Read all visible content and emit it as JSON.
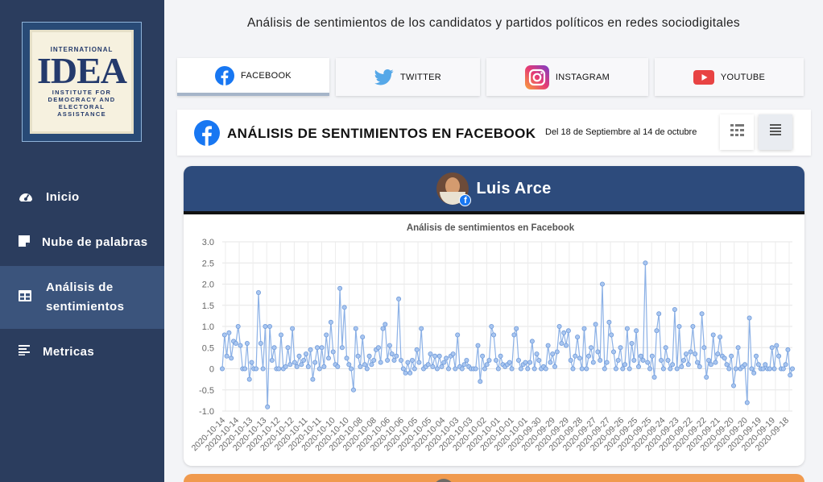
{
  "sidebar": {
    "logo": {
      "line1": "INTERNATIONAL",
      "line2": "IDEA",
      "line3": "INSTITUTE FOR",
      "line4": "DEMOCRACY AND",
      "line5": "ELECTORAL",
      "line6": "ASSISTANCE"
    },
    "items": [
      {
        "label": "Inicio",
        "icon": "speedometer-icon"
      },
      {
        "label": "Nube de palabras",
        "icon": "note-icon"
      },
      {
        "label_line1": "Análisis de",
        "label_line2": "sentimientos",
        "icon": "table-icon",
        "active": true
      },
      {
        "label": "Metricas",
        "icon": "text-lines-icon"
      }
    ]
  },
  "main": {
    "title": "Análisis de sentimientos de los candidatos y partidos políticos en redes sociodigitales",
    "tabs": [
      {
        "label": "FACEBOOK",
        "icon": "facebook-icon",
        "active": true
      },
      {
        "label": "TWITTER",
        "icon": "twitter-icon"
      },
      {
        "label": "INSTAGRAM",
        "icon": "instagram-icon"
      },
      {
        "label": "YOUTUBE",
        "icon": "youtube-icon"
      }
    ],
    "header": {
      "title": "ANÁLISIS DE SENTIMIENTOS EN FACEBOOK",
      "range": "Del 18 de Septiembre al 14 de octubre",
      "grid_icon": "grid-view-icon",
      "list_icon": "list-view-icon"
    },
    "panel": {
      "name": "Luis Arce",
      "header_color": "#2d4b7c",
      "next_panel_color": "#f09a4e"
    }
  },
  "colors": {
    "sidebar_bg": "#2b3d5e",
    "sidebar_active": "#3b547c",
    "line": "#8cb1e6",
    "marker": "#a9c6f0"
  },
  "chart_data": {
    "type": "line",
    "title": "Análisis de sentimientos en Facebook",
    "xlabel": "",
    "ylabel": "",
    "ylim": [
      -1.0,
      3.0
    ],
    "yticks": [
      3.0,
      2.5,
      2.0,
      1.5,
      1.0,
      0.5,
      0,
      -0.5,
      -1.0
    ],
    "ytick_labels": [
      "3.0",
      "2.5",
      "2.0",
      "1.5",
      "1.0",
      "0.5",
      "0",
      "-0.5",
      "-1.0"
    ],
    "grid": true,
    "x_tick_labels": [
      "2020-10-14",
      "2020-10-14",
      "2020-10-13",
      "2020-10-13",
      "2020-10-12",
      "2020-10-12",
      "2020-10-11",
      "2020-10-11",
      "2020-10-10",
      "2020-10-10",
      "2020-10-08",
      "2020-10-08",
      "2020-10-06",
      "2020-10-06",
      "2020-10-05",
      "2020-10-05",
      "2020-10-04",
      "2020-10-03",
      "2020-10-03",
      "2020-10-02",
      "2020-10-01",
      "2020-10-01",
      "2020-10-01",
      "2020-09-30",
      "2020-09-29",
      "2020-09-29",
      "2020-09-28",
      "2020-09-27",
      "2020-09-27",
      "2020-09-26",
      "2020-09-25",
      "2020-09-25",
      "2020-09-24",
      "2020-09-23",
      "2020-09-22",
      "2020-09-22",
      "2020-09-21",
      "2020-09-20",
      "2020-09-20",
      "2020-09-19",
      "2020-09-19",
      "2020-09-18"
    ],
    "series": [
      {
        "values": [
          0,
          0.8,
          0.3,
          0.85,
          0.25,
          0.65,
          0.6,
          1.0,
          0.55,
          0,
          0,
          0.6,
          -0.25,
          0.15,
          0,
          0,
          1.8,
          0.6,
          0,
          1.0,
          -0.9,
          1.0,
          0.2,
          0.5,
          0,
          0,
          0.8,
          0,
          0.05,
          0.5,
          0.1,
          0.95,
          0.15,
          0.05,
          0.3,
          0.1,
          0.2,
          0.35,
          0.05,
          0.45,
          -0.25,
          0.15,
          0.5,
          0,
          0.5,
          0.05,
          0.8,
          0.25,
          1.1,
          0.4,
          0.1,
          0.05,
          1.9,
          0.5,
          1.45,
          0.25,
          0.1,
          0,
          -0.5,
          0.95,
          0.3,
          0.05,
          0.75,
          0.1,
          0,
          0.3,
          0.1,
          0.2,
          0.45,
          0.5,
          0.15,
          0.95,
          1.05,
          0.2,
          0.55,
          0.35,
          0.2,
          0.3,
          1.65,
          0.2,
          0,
          -0.1,
          0.15,
          -0.1,
          0.2,
          0,
          0.45,
          0.15,
          0.95,
          0,
          0.05,
          0.1,
          0.35,
          0.05,
          0.3,
          0,
          0.3,
          0.05,
          0.15,
          0.25,
          0,
          0.3,
          0.35,
          0,
          0.8,
          0.05,
          0,
          0.1,
          0.2,
          0.05,
          0,
          0,
          0,
          0.55,
          -0.3,
          0.3,
          0,
          0.1,
          0.2,
          1.0,
          0.8,
          0.2,
          0,
          0.3,
          0.1,
          0.05,
          0.1,
          0.15,
          0,
          0.8,
          0.95,
          0.2,
          0,
          0.1,
          0.15,
          0,
          0.15,
          0.65,
          0,
          0.35,
          0.2,
          0,
          0.05,
          0,
          0.55,
          0.15,
          0.35,
          0.05,
          0.4,
          1.0,
          0.6,
          0.85,
          0.55,
          0.9,
          0.2,
          0,
          0.3,
          0.75,
          0.25,
          0,
          0.95,
          0,
          0.3,
          0.5,
          0.15,
          1.05,
          0.4,
          0.2,
          2.0,
          0,
          0.15,
          1.1,
          0.8,
          0.4,
          0,
          0.2,
          0.5,
          0,
          0.1,
          0.95,
          0,
          0.6,
          0.2,
          0.9,
          0.05,
          0.3,
          0.2,
          2.5,
          0.15,
          0,
          0.3,
          -0.2,
          0.9,
          1.3,
          0.2,
          0,
          0.5,
          0.2,
          0,
          0.1,
          1.4,
          0,
          1.0,
          0.05,
          0.2,
          0.35,
          0.1,
          0.4,
          1.0,
          0.35,
          0.15,
          0.05,
          1.3,
          0.5,
          -0.2,
          0.2,
          0.1,
          0.8,
          0.15,
          0.35,
          0.75,
          0.3,
          0.25,
          0.1,
          0,
          0.3,
          -0.4,
          0,
          0.5,
          0,
          0.05,
          0.1,
          -0.8,
          1.2,
          0,
          -0.1,
          0.3,
          0.1,
          0,
          0,
          0.1,
          0,
          0,
          0.5,
          0,
          0.55,
          0.3,
          0,
          0,
          0.1,
          0.45,
          -0.15,
          0
        ]
      }
    ]
  }
}
